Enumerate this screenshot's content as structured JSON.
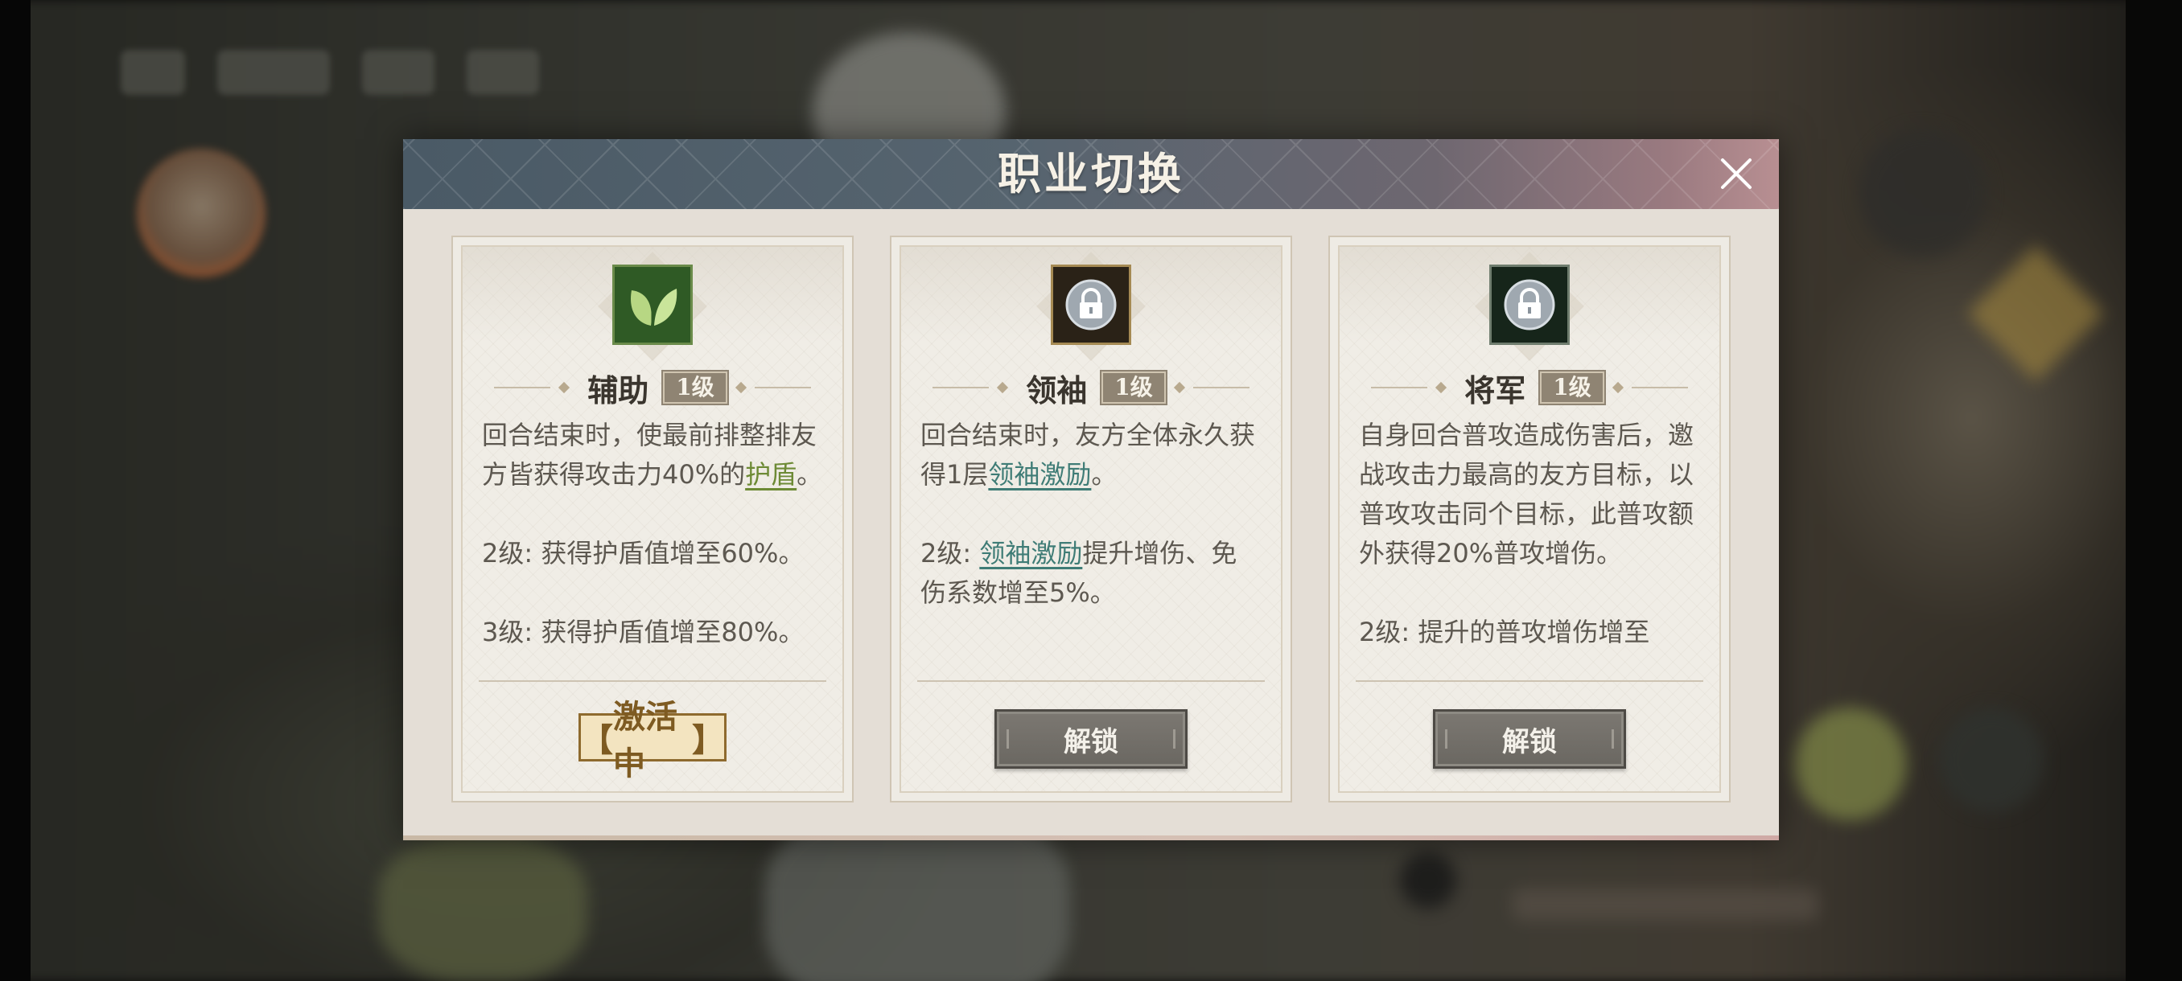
{
  "dialog": {
    "title": "职业切换",
    "close_icon": "close-icon"
  },
  "cards": [
    {
      "icon": "leaf-icon",
      "name": "辅助",
      "level": "1级",
      "desc_line1_pre": "回合结束时，使最前排整排友方皆获得攻击力40%的",
      "desc_line1_kw": "护盾",
      "desc_line1_post": "。",
      "desc_line2": "2级: 获得护盾值增至60%。",
      "desc_line3": "3级: 获得护盾值增至80%。",
      "status_label": "激活中",
      "state": "active"
    },
    {
      "icon": "lock-icon",
      "name": "领袖",
      "level": "1级",
      "desc_line1_pre": "回合结束时，友方全体永久获得1层",
      "desc_line1_kw": "领袖激励",
      "desc_line1_post": "。",
      "desc_line2_pre": "2级: ",
      "desc_line2_kw": "领袖激励",
      "desc_line2_post": "提升增伤、免伤系数增至5%。",
      "button_label": "解锁",
      "state": "locked"
    },
    {
      "icon": "lock-icon",
      "name": "将军",
      "level": "1级",
      "desc_line1": "自身回合普攻造成伤害后，邀战攻击力最高的友方目标，以普攻攻击同个目标，此普攻额外获得20%普攻增伤。",
      "desc_line2": "2级: 提升的普攻增伤增至",
      "button_label": "解锁",
      "state": "locked"
    }
  ],
  "colors": {
    "header_left": "#4a5a66",
    "header_right": "#b88f92",
    "card_bg": "#f0ede6",
    "keyword_green": "#6d8a35",
    "keyword_teal": "#3f7c76",
    "active_badge": "#7e5b22",
    "unlock_button": "#6f6c66"
  }
}
